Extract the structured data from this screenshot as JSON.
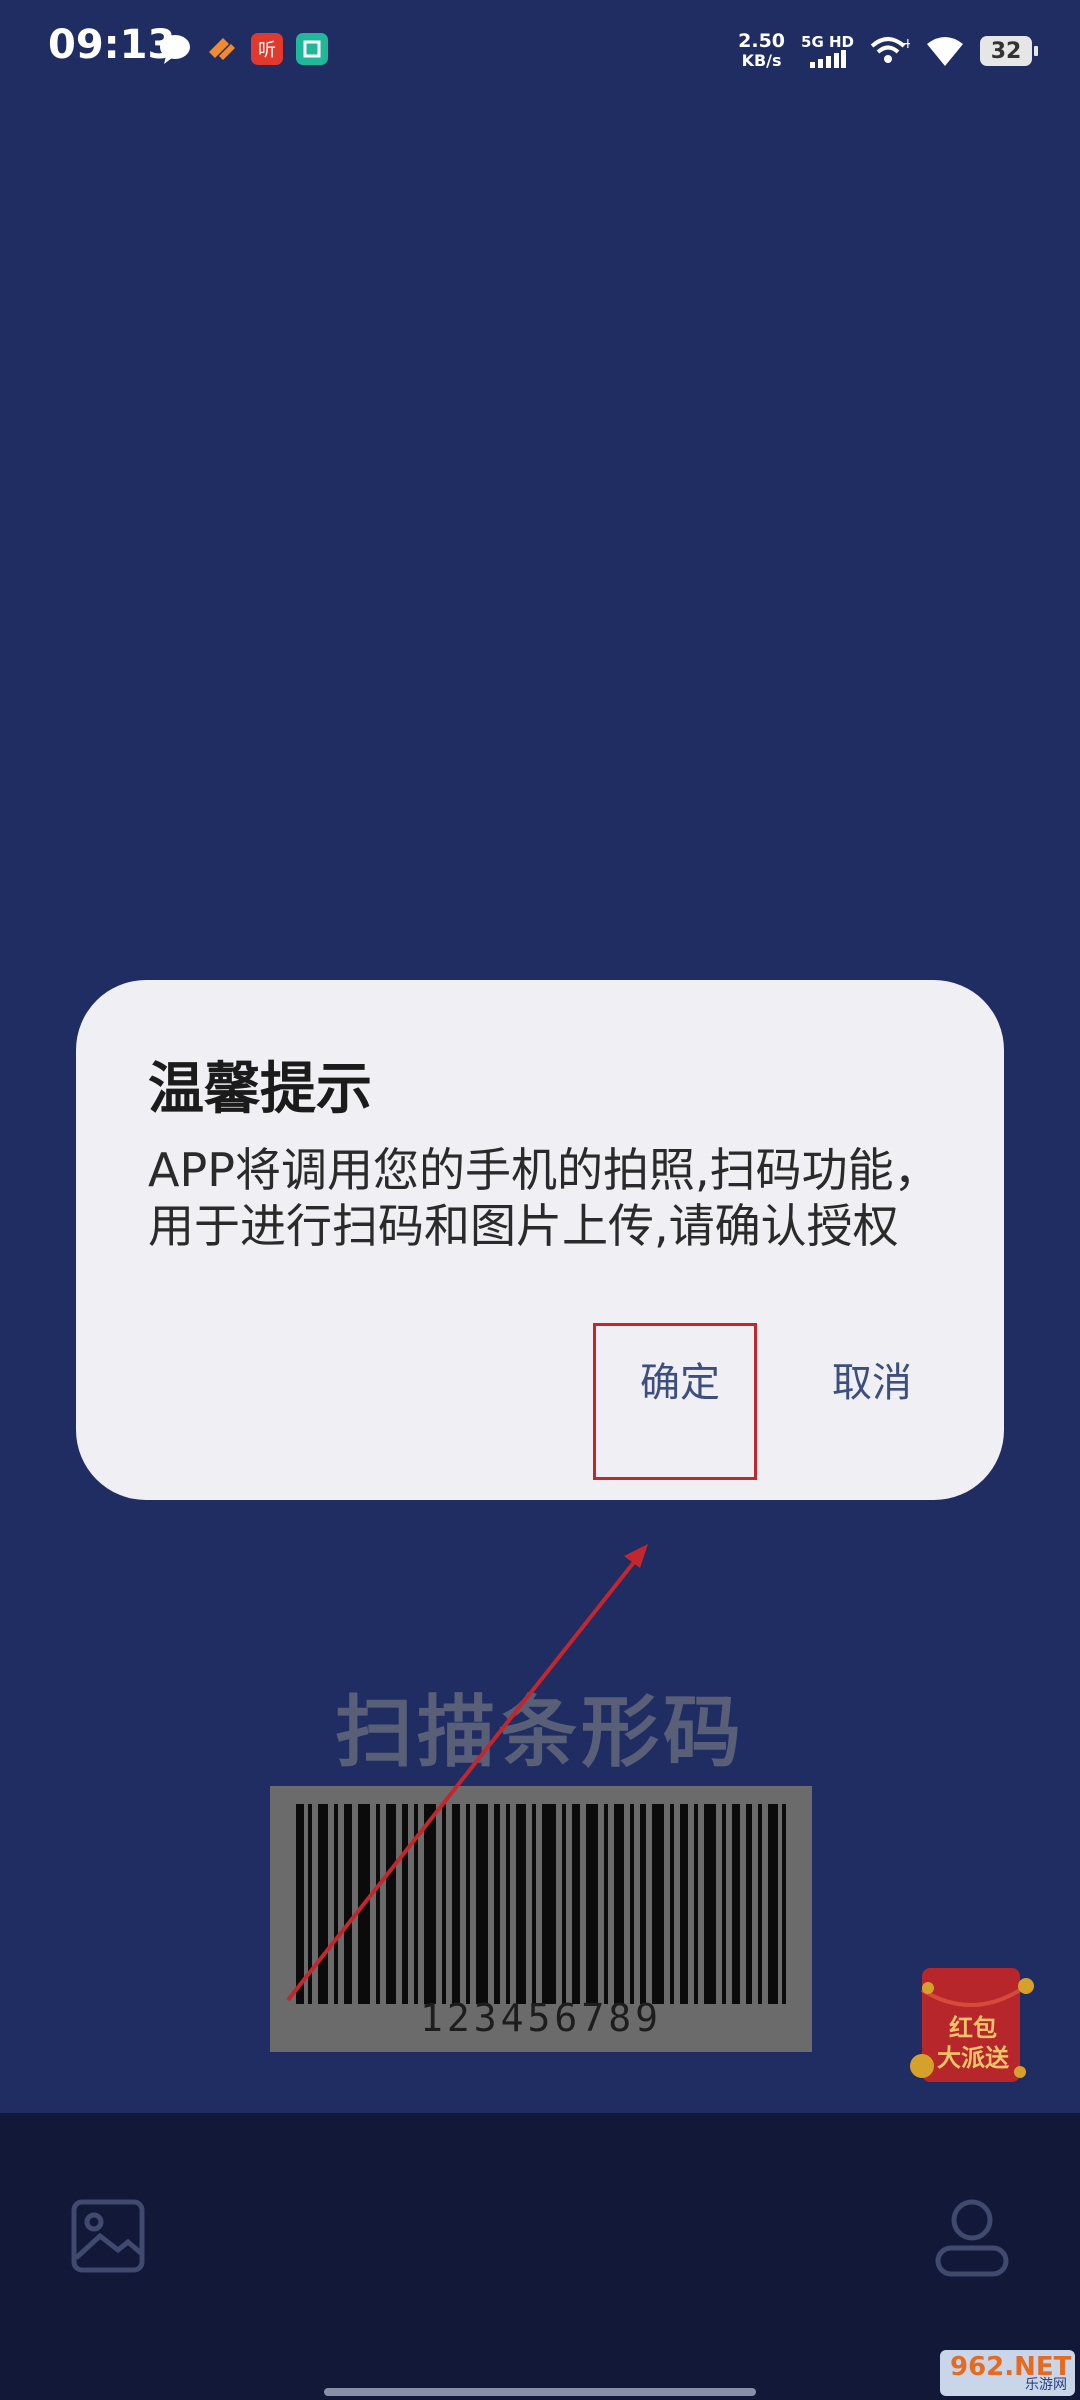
{
  "status_bar": {
    "time": "09:13",
    "net_speed_value": "2.50",
    "net_speed_unit": "KB/s",
    "network_type_top": "5G HD",
    "battery": "32",
    "notification_icons": [
      "chat-bubble-icon",
      "orange-app-icon",
      "listen-app-icon",
      "teal-app-icon"
    ]
  },
  "page": {
    "scan_title": "扫描条形码",
    "barcode_number": "123456789",
    "redpack_line1": "红包",
    "redpack_line2": "大派送"
  },
  "dialog": {
    "title": "温馨提示",
    "message": "APP将调用您的手机的拍照,扫码功能，用于进行扫码和图片上传,请确认授权",
    "confirm_label": "确定",
    "cancel_label": "取消"
  },
  "bottom_nav": {
    "left_icon": "gallery-icon",
    "right_icon": "user-icon"
  },
  "watermark": {
    "brand": "962.NET",
    "sub": "乐游网"
  },
  "colors": {
    "background": "#1f2d63",
    "dialog_bg": "#efeff4",
    "button_text": "#3d4f7e",
    "highlight": "#c2272d"
  }
}
